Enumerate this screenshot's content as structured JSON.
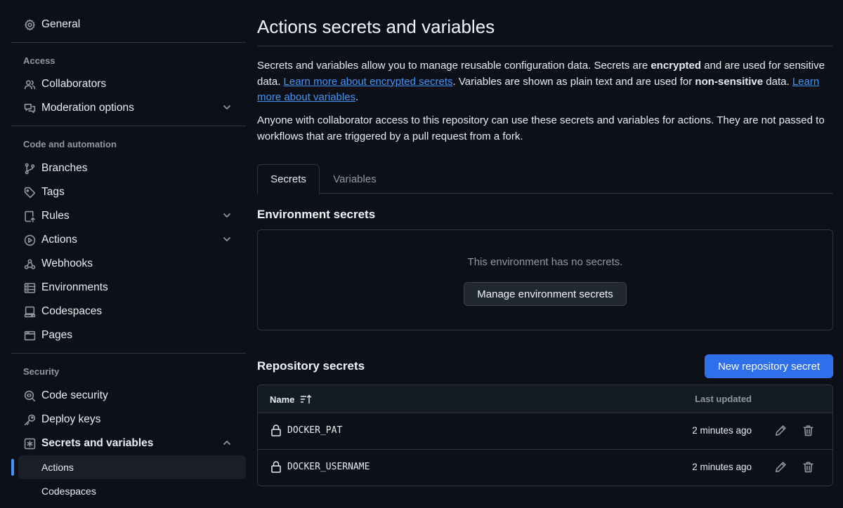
{
  "sidebar": {
    "general": "General",
    "sections": {
      "access": "Access",
      "code_automation": "Code and automation",
      "security": "Security"
    },
    "items": {
      "collaborators": "Collaborators",
      "moderation": "Moderation options",
      "branches": "Branches",
      "tags": "Tags",
      "rules": "Rules",
      "actions": "Actions",
      "webhooks": "Webhooks",
      "environments": "Environments",
      "codespaces": "Codespaces",
      "pages": "Pages",
      "code_security": "Code security",
      "deploy_keys": "Deploy keys",
      "secrets_variables": "Secrets and variables"
    },
    "sub_items": {
      "actions": "Actions",
      "codespaces": "Codespaces"
    }
  },
  "main": {
    "title": "Actions secrets and variables",
    "intro": {
      "p1_a": "Secrets and variables allow you to manage reusable configuration data. Secrets are ",
      "p1_b": "encrypted",
      "p1_c": " and are used for sensitive data. ",
      "p1_link1": "Learn more about encrypted secrets",
      "p1_d": ". Variables are shown as plain text and are used for ",
      "p1_e": "non-sensitive",
      "p1_f": " data. ",
      "p1_link2": "Learn more about variables",
      "p1_g": ".",
      "p2": "Anyone with collaborator access to this repository can use these secrets and variables for actions. They are not passed to workflows that are triggered by a pull request from a fork."
    },
    "tabs": {
      "secrets": "Secrets",
      "variables": "Variables"
    },
    "environment": {
      "heading": "Environment secrets",
      "empty": "This environment has no secrets.",
      "manage_button": "Manage environment secrets"
    },
    "repository": {
      "heading": "Repository secrets",
      "new_button": "New repository secret",
      "columns": {
        "name": "Name",
        "last_updated": "Last updated"
      },
      "rows": [
        {
          "name": "DOCKER_PAT",
          "updated": "2 minutes ago"
        },
        {
          "name": "DOCKER_USERNAME",
          "updated": "2 minutes ago"
        }
      ]
    }
  },
  "colors": {
    "background": "#0d1117",
    "accent": "#4493f8",
    "primary_button": "#2f6feb",
    "border": "#30363d"
  }
}
